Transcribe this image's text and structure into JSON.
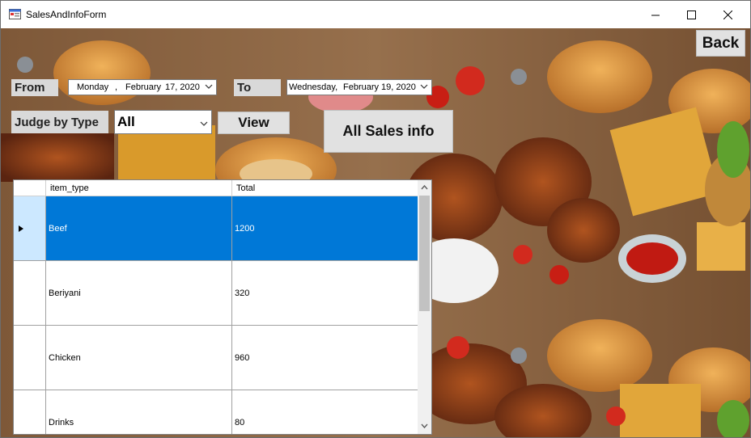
{
  "window": {
    "title": "SalesAndInfoForm"
  },
  "filters": {
    "from_label": "From",
    "from_date": {
      "day": "Monday",
      "sep": ",",
      "month": "February",
      "date": "17, 2020"
    },
    "to_label": "To",
    "to_date": {
      "day": "Wednesday,",
      "month": "February",
      "date": "19, 2020"
    },
    "judge_label": "Judge by Type",
    "type_value": "All"
  },
  "buttons": {
    "back": "Back",
    "view": "View",
    "all_sales": "All Sales info"
  },
  "grid": {
    "columns": [
      "item_type",
      "Total"
    ],
    "rows": [
      {
        "item_type": "Beef",
        "total": "1200"
      },
      {
        "item_type": "Beriyani",
        "total": "320"
      },
      {
        "item_type": "Chicken",
        "total": "960"
      },
      {
        "item_type": "Drinks",
        "total": "80"
      }
    ]
  },
  "colors": {
    "selection": "#0078d7",
    "row_header_selected": "#cce8ff"
  }
}
